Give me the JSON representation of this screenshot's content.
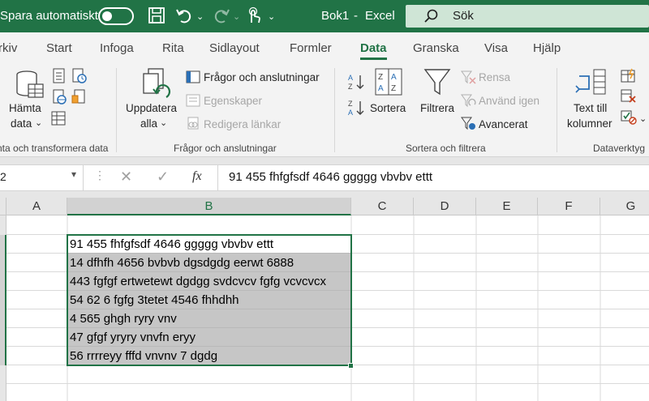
{
  "titlebar": {
    "autosave_label": "Spara automatiskt",
    "doc_title": "Bok1",
    "separator": "-",
    "app_name": "Excel",
    "search_label": "Sök"
  },
  "tabs": [
    "rkiv",
    "Start",
    "Infoga",
    "Rita",
    "Sidlayout",
    "Formler",
    "Data",
    "Granska",
    "Visa",
    "Hjälp"
  ],
  "active_tab": "Data",
  "ribbon": {
    "get_data_l1": "Hämta",
    "get_data_l2": "data",
    "group1_label": "nta och transformera data",
    "refresh_l1": "Uppdatera",
    "refresh_l2": "alla",
    "queries_connections": "Frågor och anslutningar",
    "properties": "Egenskaper",
    "edit_links": "Redigera länkar",
    "group2_label": "Frågor och anslutningar",
    "sort": "Sortera",
    "filter": "Filtrera",
    "clear": "Rensa",
    "reapply": "Använd igen",
    "advanced": "Avancerat",
    "group3_label": "Sortera och filtrera",
    "text_to_cols_l1": "Text till",
    "text_to_cols_l2": "kolumner",
    "group4_label": "Dataverktyg"
  },
  "formula_bar": {
    "name_box": "2",
    "fx": "fx",
    "content": "91 455 fhfgfsdf 4646 ggggg vbvbv ettt"
  },
  "columns": [
    "A",
    "B",
    "C",
    "D",
    "E",
    "F",
    "G"
  ],
  "cells": [
    "91 455 fhfgfsdf 4646 ggggg vbvbv ettt",
    "14 dfhfh 4656 bvbvb dgsdgdg eerwt 6888",
    "443 fgfgf ertwetewt dgdgg svdcvcv fgfg vcvcvcx",
    "54 62 6 fgfg 3tetet 4546 fhhdhh",
    "4 565 ghgh ryry vnv",
    "47 gfgf yryry vnvfn eryy",
    "56 rrrreyy fffd vnvnv 7 dgdg"
  ],
  "colors": {
    "brand": "#217346",
    "selection": "#c6c6c6"
  }
}
